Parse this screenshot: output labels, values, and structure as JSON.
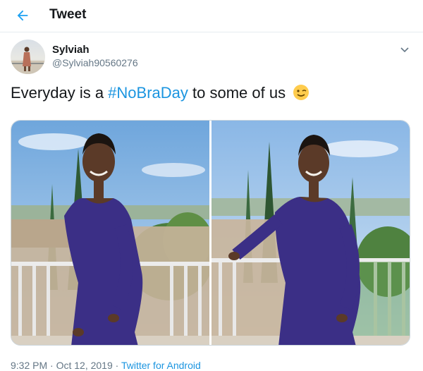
{
  "header": {
    "title": "Tweet",
    "back_icon": "arrow-left-icon",
    "accent": "#1da1f2"
  },
  "tweet": {
    "author_name": "Sylviah",
    "author_handle": "@Sylviah90560276",
    "text_before": "Everyday is a ",
    "hashtag": "#NoBraDay",
    "text_after": " to some of us",
    "emoji_icon": "winking-face-icon",
    "timestamp": "9:32 PM · Oct 12, 2019 · ",
    "source": "Twitter for Android"
  },
  "colors": {
    "link": "#1b95e0",
    "muted": "#657786",
    "border": "#e6ecf0"
  }
}
